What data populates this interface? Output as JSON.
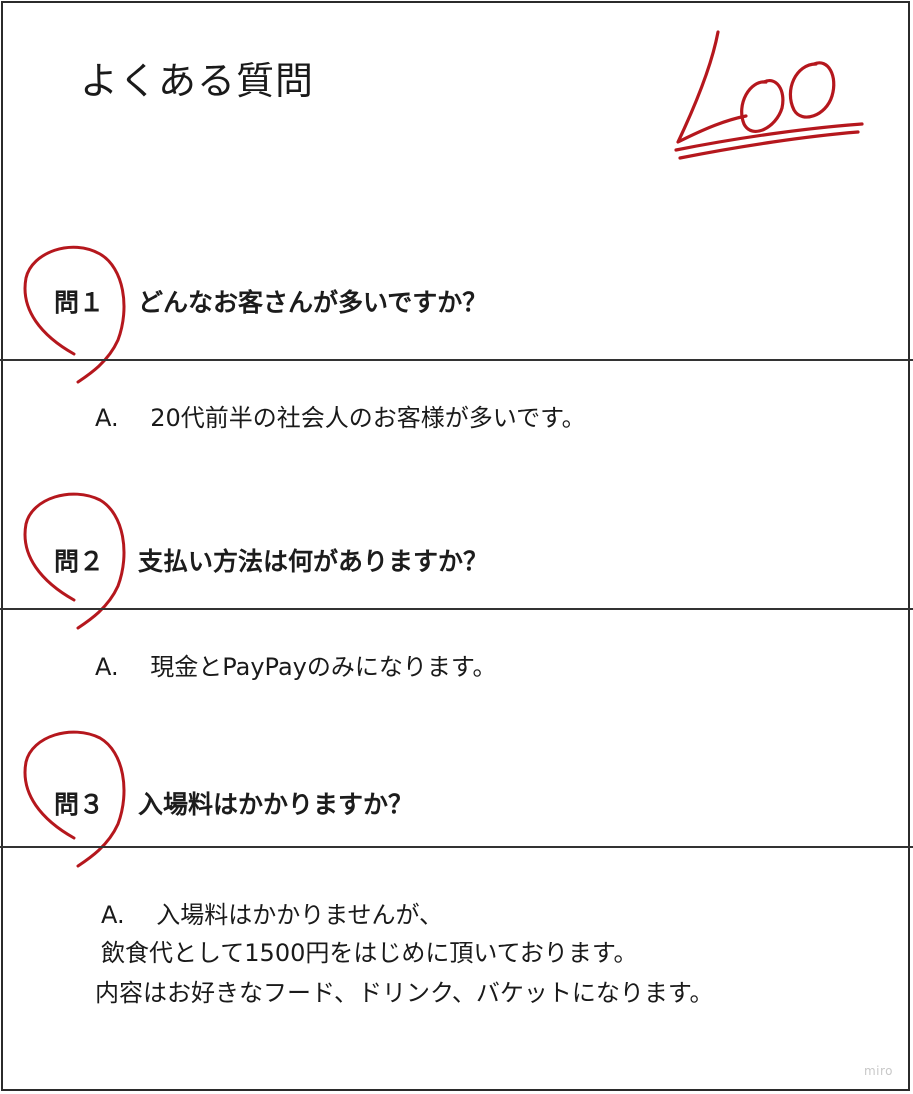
{
  "page": {
    "title": "よくある質問"
  },
  "score_mark": {
    "text": "100",
    "color": "#b5171d"
  },
  "faq": [
    {
      "label": "問１",
      "question": "どんなお客さんが多いですか？",
      "answer_lines": [
        "A.　 20代前半の社会人のお客様が多いです。"
      ]
    },
    {
      "label": "問２",
      "question": "支払い方法は何がありますか？",
      "answer_lines": [
        "A.　 現金とPayPayのみになります。"
      ]
    },
    {
      "label": "問３",
      "question": "入場料はかかりますか？",
      "answer_lines": [
        "A.　 入場料はかかりませんが、",
        "飲食代として1500円をはじめに頂いております。",
        "内容はお好きなフード、ドリンク、バケットになります。"
      ]
    }
  ],
  "watermark": "miro",
  "colors": {
    "ink": "#1c1c1c",
    "correction": "#b5171d",
    "rule": "#333333"
  }
}
